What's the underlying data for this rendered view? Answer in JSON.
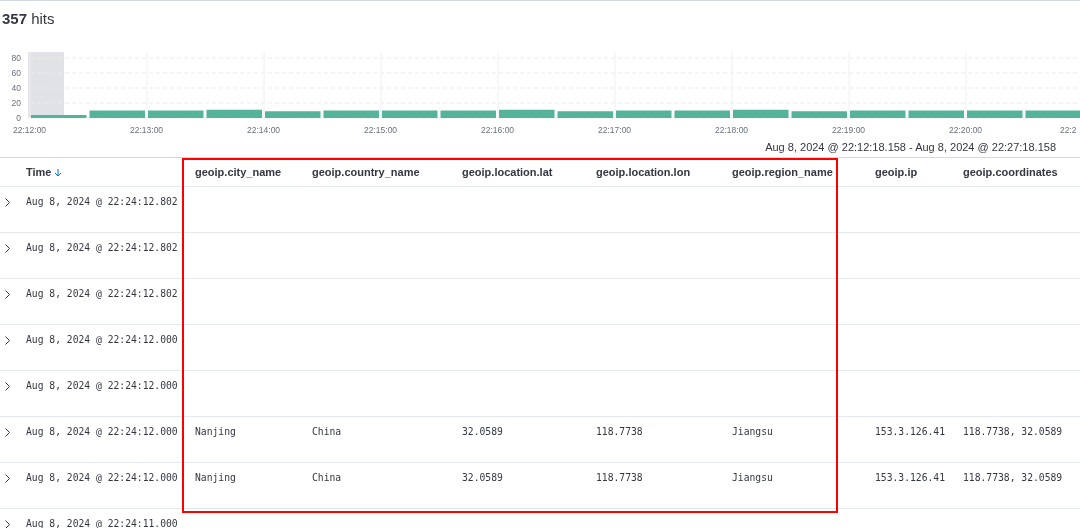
{
  "summary": "**357** hits",
  "histogram": {
    "chart_data": {
      "type": "bar",
      "categories": [
        "22:12:00",
        null,
        "22:13:00",
        null,
        "22:14:00",
        null,
        "22:15:00",
        null,
        "22:16:00",
        null,
        "22:17:00",
        null,
        "22:18:00",
        null,
        "22:19:00",
        null,
        "22:20:00",
        null,
        "22:2"
      ],
      "series": [
        {
          "color": "#54b399",
          "values": [
            4,
            10,
            10,
            11,
            9,
            10,
            10,
            10,
            11,
            9,
            10,
            10,
            11,
            9,
            10,
            10,
            10,
            10,
            null
          ]
        }
      ],
      "ylim": [
        0,
        80
      ],
      "yticks": [
        0,
        20,
        40,
        60,
        80
      ],
      "grid": true
    },
    "time_range": "Aug 8, 2024 @ 22:12:18.158 - Aug 8, 2024 @ 22:27:18.158"
  },
  "table": {
    "columns": [
      {
        "label": "Time",
        "sorted": true
      },
      {
        "label": "geoip.city_name",
        "sorted": false
      },
      {
        "label": "geoip.country_name",
        "sorted": false
      },
      {
        "label": "geoip.location.lat",
        "sorted": false
      },
      {
        "label": "geoip.location.lon",
        "sorted": false
      },
      {
        "label": "geoip.region_name",
        "sorted": false
      },
      {
        "label": "geoip.ip",
        "sorted": false
      },
      {
        "label": "geoip.coordinates",
        "sorted": false
      }
    ],
    "rows": [
      {
        "cells": [
          "Aug 8, 2024 @ 22:24:12.802"
        ]
      },
      {
        "cells": [
          "Aug 8, 2024 @ 22:24:12.802"
        ]
      },
      {
        "cells": [
          "Aug 8, 2024 @ 22:24:12.802"
        ]
      },
      {
        "cells": [
          "Aug 8, 2024 @ 22:24:12.000"
        ]
      },
      {
        "cells": [
          "Aug 8, 2024 @ 22:24:12.000"
        ]
      },
      {
        "cells": [
          "Aug 8, 2024 @ 22:24:12.000",
          "Nanjing",
          "China",
          "32.0589",
          "118.7738",
          "Jiangsu",
          "153.3.126.41",
          "118.7738, 32.0589"
        ]
      },
      {
        "cells": [
          "Aug 8, 2024 @ 22:24:12.000",
          "Nanjing",
          "China",
          "32.0589",
          "118.7738",
          "Jiangsu",
          "153.3.126.41",
          "118.7738, 32.0589"
        ]
      },
      {
        "cells": [
          "Aug 8, 2024 @ 22:24:11.000"
        ]
      }
    ]
  }
}
